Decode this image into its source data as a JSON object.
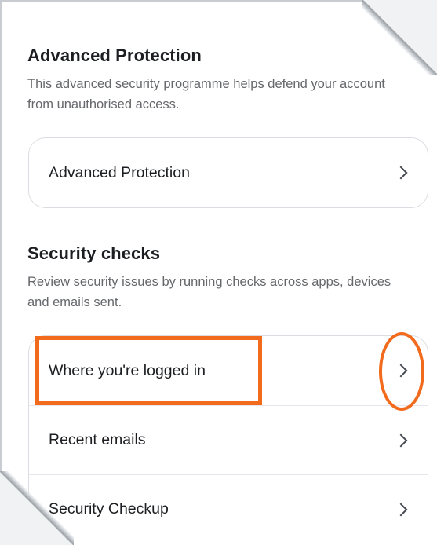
{
  "advanced_protection": {
    "title": "Advanced Protection",
    "description": "This advanced security programme helps defend your account from unauthorised access.",
    "items": [
      {
        "label": "Advanced Protection"
      }
    ]
  },
  "security_checks": {
    "title": "Security checks",
    "description": "Review security issues by running checks across apps, devices and emails sent.",
    "items": [
      {
        "label": "Where you're logged in"
      },
      {
        "label": "Recent emails"
      },
      {
        "label": "Security Checkup"
      }
    ]
  },
  "annotation": {
    "color": "#f26a1b",
    "highlighted_item": "Where you're logged in"
  },
  "icons": {
    "chevron": "chevron-right-icon"
  }
}
